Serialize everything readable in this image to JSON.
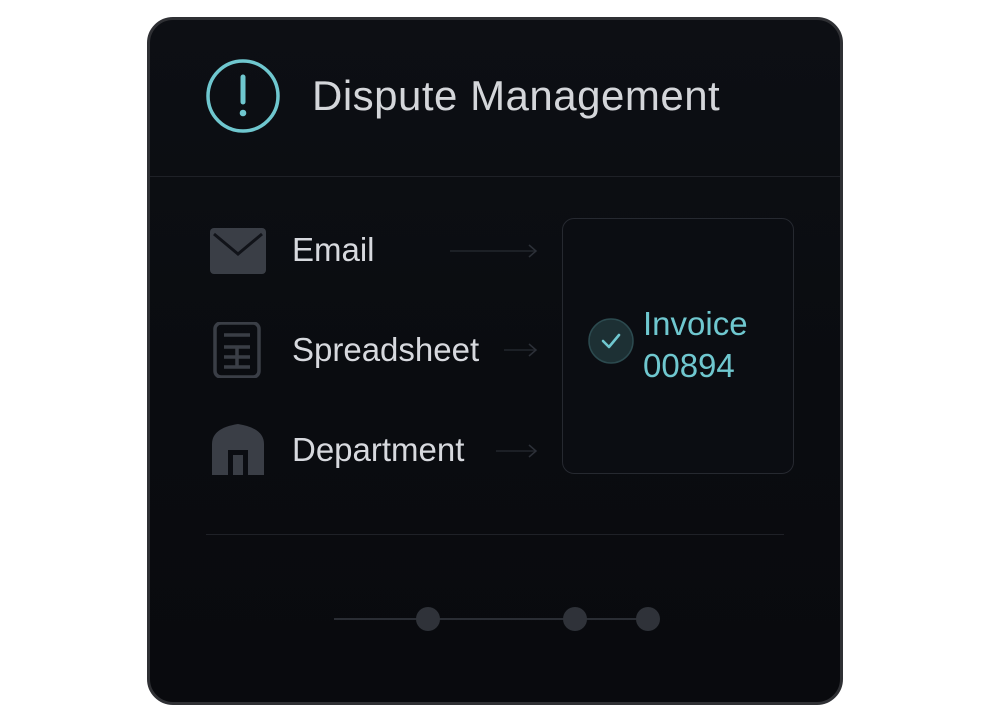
{
  "header": {
    "title": "Dispute Management",
    "icon": "alert-circle-icon"
  },
  "sources": [
    {
      "label": "Email",
      "icon": "envelope-icon"
    },
    {
      "label": "Spreadsheet",
      "icon": "spreadsheet-icon"
    },
    {
      "label": "Department",
      "icon": "building-icon"
    }
  ],
  "target": {
    "line1": "Invoice",
    "line2": "00894",
    "icon": "check-circle-icon"
  },
  "stepper": {
    "steps": 3
  },
  "colors": {
    "accent": "#6fc7cf",
    "background": "#0b0d12",
    "text": "#d7d9de",
    "muted_icon": "#3a3e46"
  }
}
